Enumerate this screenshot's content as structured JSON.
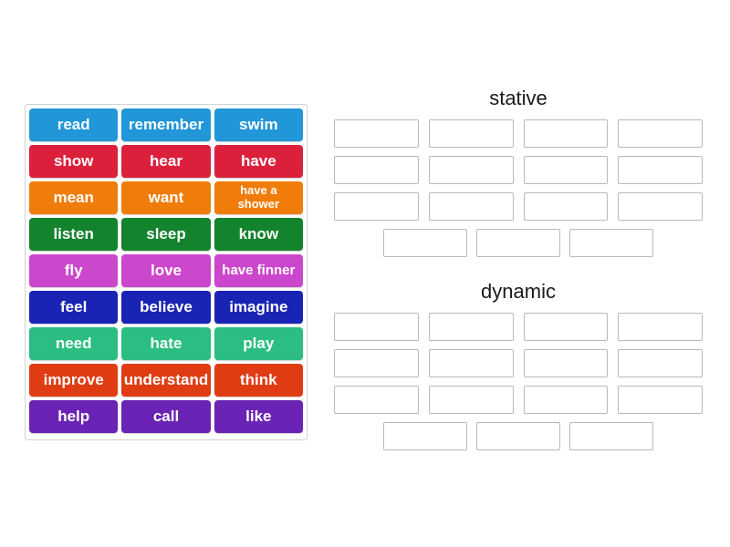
{
  "tiles": {
    "rows": [
      {
        "color": "#2196d8",
        "items": [
          {
            "label": "read"
          },
          {
            "label": "remember"
          },
          {
            "label": "swim"
          }
        ]
      },
      {
        "color": "#dc203c",
        "items": [
          {
            "label": "show"
          },
          {
            "label": "hear"
          },
          {
            "label": "have"
          }
        ]
      },
      {
        "color": "#f07c0a",
        "items": [
          {
            "label": "mean"
          },
          {
            "label": "want"
          },
          {
            "label": "have a\nshower",
            "style": "two-line"
          }
        ]
      },
      {
        "color": "#14832e",
        "items": [
          {
            "label": "listen"
          },
          {
            "label": "sleep"
          },
          {
            "label": "know"
          }
        ]
      },
      {
        "color": "#cb47cb",
        "items": [
          {
            "label": "fly"
          },
          {
            "label": "love"
          },
          {
            "label": "have finner",
            "style": "small"
          }
        ]
      },
      {
        "color": "#1a24b4",
        "items": [
          {
            "label": "feel"
          },
          {
            "label": "believe"
          },
          {
            "label": "imagine"
          }
        ]
      },
      {
        "color": "#2bbd82",
        "items": [
          {
            "label": "need"
          },
          {
            "label": "hate"
          },
          {
            "label": "play"
          }
        ]
      },
      {
        "color": "#e03c14",
        "items": [
          {
            "label": "improve"
          },
          {
            "label": "understand"
          },
          {
            "label": "think"
          }
        ]
      },
      {
        "color": "#6a23b4",
        "items": [
          {
            "label": "help"
          },
          {
            "label": "call"
          },
          {
            "label": "like"
          }
        ]
      }
    ]
  },
  "groups": [
    {
      "id": "stative",
      "title": "stative",
      "slot_rows": [
        {
          "count": 4,
          "centered": false
        },
        {
          "count": 4,
          "centered": false
        },
        {
          "count": 4,
          "centered": false
        },
        {
          "count": 3,
          "centered": true
        }
      ]
    },
    {
      "id": "dynamic",
      "title": "dynamic",
      "slot_rows": [
        {
          "count": 4,
          "centered": false
        },
        {
          "count": 4,
          "centered": false
        },
        {
          "count": 4,
          "centered": false
        },
        {
          "count": 3,
          "centered": true
        }
      ]
    }
  ],
  "colors": {
    "background": "#ffffff",
    "panel_border": "#d2d2d2",
    "slot_border": "#b9b9b9",
    "slot_fill": "#ffffff",
    "title_text": "#1a1a1a",
    "tile_text": "#ffffff"
  }
}
